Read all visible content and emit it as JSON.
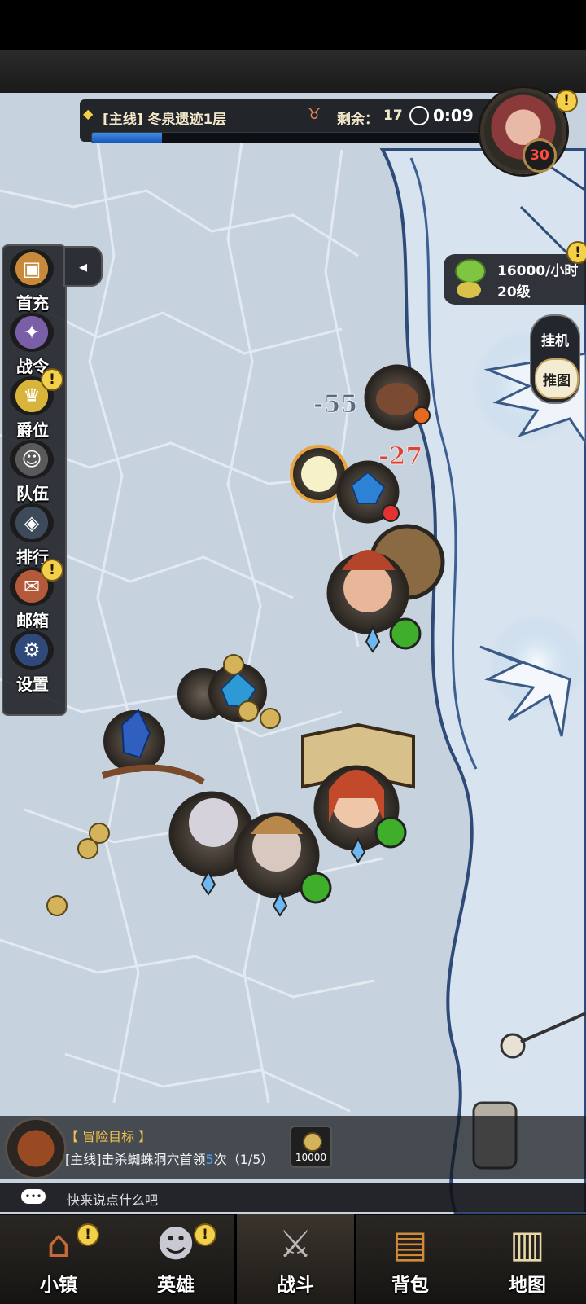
{
  "stage": {
    "title": "[主线] 冬泉遗迹1层",
    "remaining_label": "剩余：",
    "remaining_count": "17",
    "timer": "0:09",
    "progress": 0.18
  },
  "boss": {
    "level": "30"
  },
  "side_menu": {
    "items": [
      {
        "label": "首充",
        "icon": "treasure-chest-icon",
        "alert": false
      },
      {
        "label": "战令",
        "icon": "winged-crest-icon",
        "alert": false
      },
      {
        "label": "爵位",
        "icon": "crown-icon",
        "alert": true
      },
      {
        "label": "队伍",
        "icon": "team-faces-icon",
        "alert": false
      },
      {
        "label": "排行",
        "icon": "ranking-emblem-icon",
        "alert": false
      },
      {
        "label": "邮箱",
        "icon": "mail-envelope-icon",
        "alert": true
      },
      {
        "label": "设置",
        "icon": "gear-icon",
        "alert": false
      }
    ]
  },
  "income": {
    "rate": "16000/小时",
    "level": "20级"
  },
  "auto_toggle": {
    "idle": "挂机",
    "push": "推图"
  },
  "damage": [
    "-55",
    "-27"
  ],
  "quest": {
    "title": "【 冒险目标 】",
    "desc_prefix": "[主线]击杀蜘蛛洞穴首领",
    "desc_count": "5",
    "desc_suffix": "次（1/5）",
    "reward_amount": "10000"
  },
  "chat": {
    "placeholder": "快来说点什么吧"
  },
  "nav": {
    "tabs": [
      {
        "label": "小镇",
        "icon": "town-icon",
        "alert": true,
        "active": false
      },
      {
        "label": "英雄",
        "icon": "hero-icon",
        "alert": true,
        "active": false
      },
      {
        "label": "战斗",
        "icon": "crossed-swords-icon",
        "alert": false,
        "active": true
      },
      {
        "label": "背包",
        "icon": "backpack-icon",
        "alert": false,
        "active": false
      },
      {
        "label": "地图",
        "icon": "map-scroll-icon",
        "alert": false,
        "active": false
      }
    ]
  },
  "colors": {
    "accent_gold": "#f3d04a",
    "progress_blue": "#3f8ee8",
    "damage_red": "#d8433a",
    "damage_grey": "#5a6a7c"
  }
}
